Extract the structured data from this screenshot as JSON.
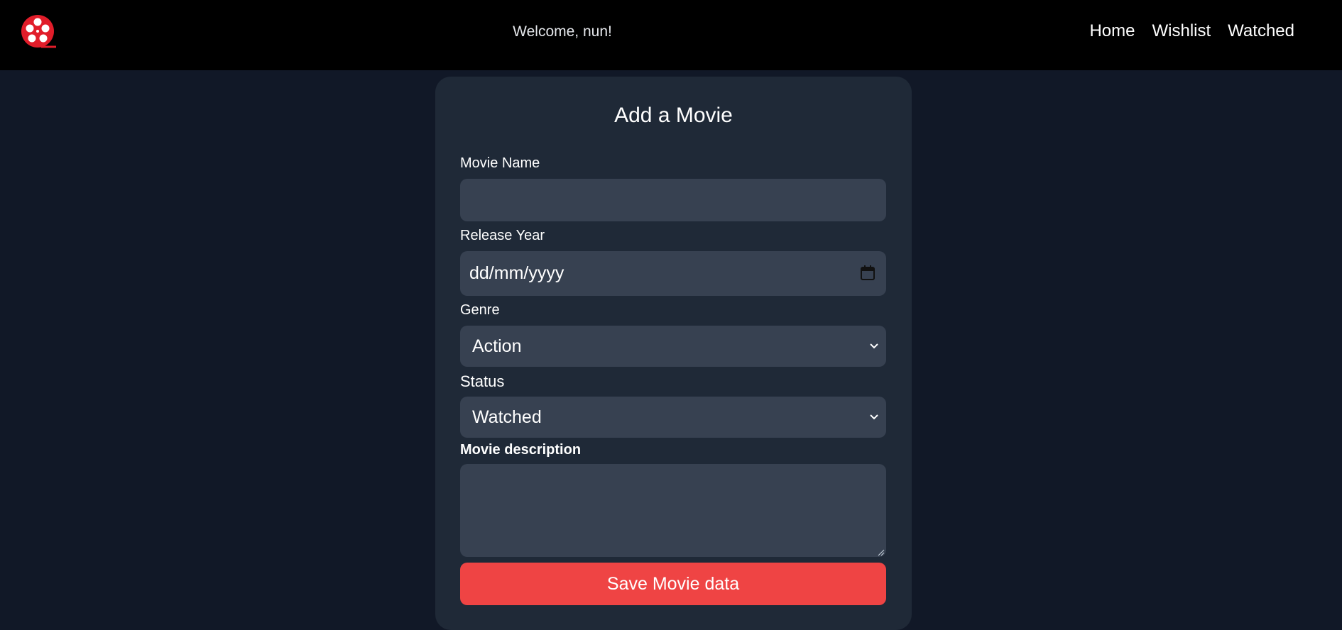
{
  "header": {
    "logo_icon": "film-reel-icon",
    "welcome_text": "Welcome, nun!",
    "nav": [
      {
        "label": "Home"
      },
      {
        "label": "Wishlist"
      },
      {
        "label": "Watched"
      }
    ]
  },
  "form": {
    "title": "Add a Movie",
    "movie_name": {
      "label": "Movie Name",
      "value": ""
    },
    "release_year": {
      "label": "Release Year",
      "placeholder": "dd/mm/yyyy",
      "icon": "calendar-icon"
    },
    "genre": {
      "label": "Genre",
      "selected": "Action",
      "icon": "chevron-down-icon"
    },
    "status": {
      "label": "Status",
      "selected": "Watched",
      "icon": "chevron-down-icon"
    },
    "description": {
      "label": "Movie description",
      "value": ""
    },
    "save_label": "Save Movie data"
  },
  "colors": {
    "page_bg": "#111827",
    "card_bg": "#1f2937",
    "field_bg": "#374151",
    "accent": "#ef4444",
    "navbar_bg": "#000000",
    "logo_red": "#e11d2a"
  }
}
